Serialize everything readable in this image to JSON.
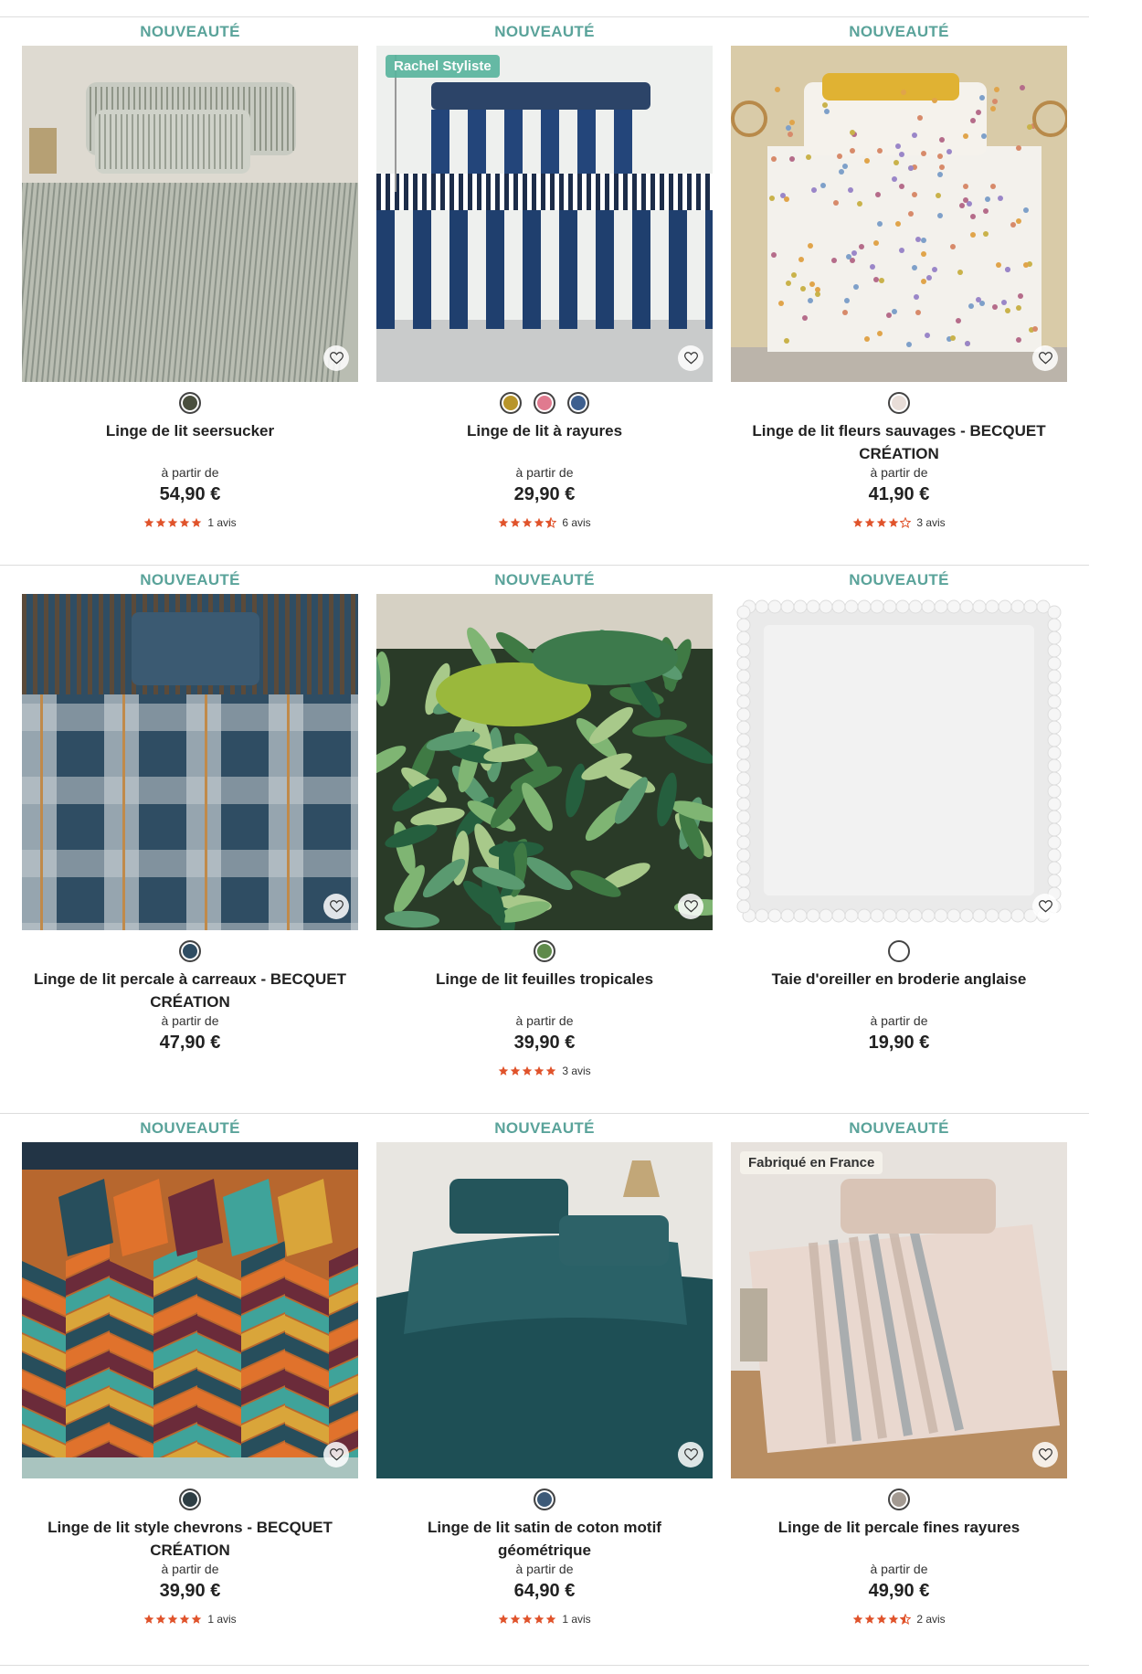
{
  "products": [
    {
      "badge": "NOUVEAUTÉ",
      "name": "Linge de lit seersucker",
      "from_label": "à partir de",
      "price": "54,90 €",
      "rating": 5,
      "reviews": "1 avis",
      "tag": "",
      "swatches": [
        "#4a4f3e"
      ],
      "image": "seersucker"
    },
    {
      "badge": "NOUVEAUTÉ",
      "name": "Linge de lit à rayures",
      "from_label": "à partir de",
      "price": "29,90 €",
      "rating": 4.5,
      "reviews": "6 avis",
      "tag": "Rachel Styliste",
      "swatches": [
        "#b8952a",
        "#e07a8f",
        "#3d5f8f"
      ],
      "image": "stripes"
    },
    {
      "badge": "NOUVEAUTÉ",
      "name": "Linge de lit fleurs sauvages - BECQUET CRÉATION",
      "from_label": "à partir de",
      "price": "41,90 €",
      "rating": 4,
      "reviews": "3 avis",
      "tag": "",
      "swatches": [
        "#e8ddd8"
      ],
      "image": "floral"
    },
    {
      "badge": "NOUVEAUTÉ",
      "name": "Linge de lit percale à carreaux - BECQUET CRÉATION",
      "from_label": "à partir de",
      "price": "47,90 €",
      "rating": 0,
      "reviews": "",
      "tag": "",
      "swatches": [
        "#2f4d63"
      ],
      "image": "plaid"
    },
    {
      "badge": "NOUVEAUTÉ",
      "name": "Linge de lit feuilles tropicales",
      "from_label": "à partir de",
      "price": "39,90 €",
      "rating": 5,
      "reviews": "3 avis",
      "tag": "",
      "swatches": [
        "#5e8a4a"
      ],
      "image": "tropical"
    },
    {
      "badge": "NOUVEAUTÉ",
      "name": "Taie d'oreiller en broderie anglaise",
      "from_label": "à partir de",
      "price": "19,90 €",
      "rating": 0,
      "reviews": "",
      "tag": "",
      "swatches": [
        "#ffffff"
      ],
      "image": "pillow"
    },
    {
      "badge": "NOUVEAUTÉ",
      "name": "Linge de lit style chevrons - BECQUET CRÉATION",
      "from_label": "à partir de",
      "price": "39,90 €",
      "rating": 5,
      "reviews": "1 avis",
      "tag": "",
      "swatches": [
        "#2e3e44"
      ],
      "image": "chevron"
    },
    {
      "badge": "NOUVEAUTÉ",
      "name": "Linge de lit satin de coton motif géométrique",
      "from_label": "à partir de",
      "price": "64,90 €",
      "rating": 5,
      "reviews": "1 avis",
      "tag": "",
      "swatches": [
        "#3d5a78"
      ],
      "image": "teal"
    },
    {
      "badge": "NOUVEAUTÉ",
      "name": "Linge de lit percale fines rayures",
      "from_label": "à partir de",
      "price": "49,90 €",
      "rating": 4.5,
      "reviews": "2 avis",
      "tag": "Fabriqué en France",
      "swatches": [
        "#a39a92"
      ],
      "image": "finestripes"
    }
  ],
  "colors": {
    "badge": "#5aa39a",
    "star": "#e0532b",
    "divider": "#dddddd"
  },
  "icons": {
    "wishlist": "heart-icon",
    "rating": "star-icon"
  }
}
